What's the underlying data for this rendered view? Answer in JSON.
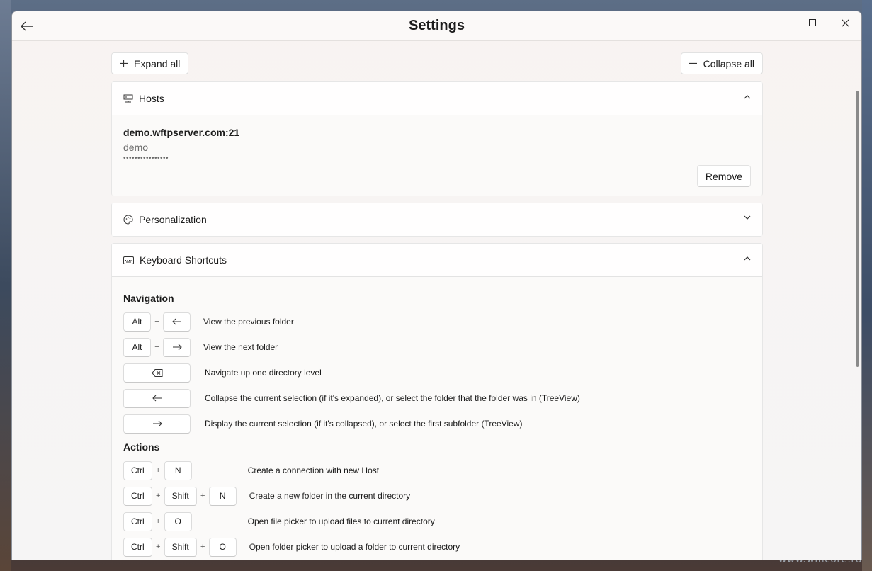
{
  "window": {
    "title": "Settings"
  },
  "toolbar": {
    "expand_all": "Expand all",
    "collapse_all": "Collapse all"
  },
  "hosts": {
    "header": "Hosts",
    "host": "demo.wftpserver.com:21",
    "user": "demo",
    "password_mask": "••••••••••••••••",
    "remove_label": "Remove"
  },
  "personalization": {
    "header": "Personalization"
  },
  "shortcuts": {
    "header": "Keyboard Shortcuts",
    "navigation": {
      "title": "Navigation",
      "rows": [
        {
          "key1": "Alt",
          "desc": "View the previous folder"
        },
        {
          "key1": "Alt",
          "desc": "View the next folder"
        },
        {
          "desc": "Navigate up one directory level"
        },
        {
          "desc": "Collapse the current selection (if it's expanded), or select the folder that the folder was in (TreeView)"
        },
        {
          "desc": "Display the current selection (if it's collapsed), or select the first subfolder (TreeView)"
        }
      ]
    },
    "actions": {
      "title": "Actions",
      "rows": [
        {
          "keys": [
            "Ctrl",
            "N"
          ],
          "desc": "Create a connection with new Host"
        },
        {
          "keys": [
            "Ctrl",
            "Shift",
            "N"
          ],
          "desc": "Create a new folder in the current directory"
        },
        {
          "keys": [
            "Ctrl",
            "O"
          ],
          "desc": "Open file picker to upload files to current directory"
        },
        {
          "keys": [
            "Ctrl",
            "Shift",
            "O"
          ],
          "desc": "Open folder picker to upload a folder to current directory"
        }
      ]
    },
    "plus": "+"
  },
  "watermark": "www.wincore.ru"
}
